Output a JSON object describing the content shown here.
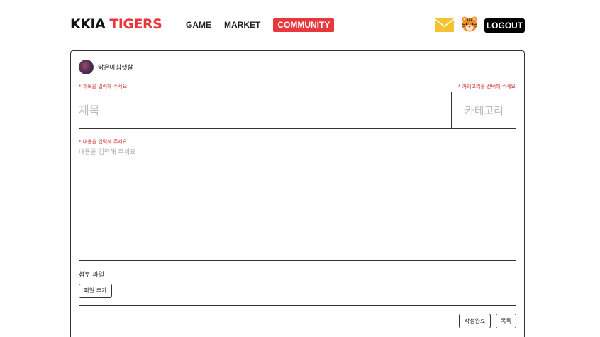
{
  "header": {
    "logo_part1": "KKIA",
    "logo_part2": " TIGERS",
    "nav": [
      {
        "label": "GAME",
        "active": false
      },
      {
        "label": "MARKET",
        "active": false
      },
      {
        "label": "COMMUNITY",
        "active": true
      }
    ],
    "icons": [
      "mail-icon",
      "tiger-icon"
    ],
    "logout_label": "LOGOUT"
  },
  "colors": {
    "accent": "#e8383d",
    "logout_bg": "#000000",
    "required_text": "#d23a3a",
    "mail": "#f5c331"
  },
  "form": {
    "author_name": "맑은아침햇살",
    "title_required": "* 제목을 입력해 주세요",
    "category_required": "* 카테고리를 선택해 주세요",
    "title_placeholder": "제목",
    "title_value": "",
    "category_placeholder": "카테고리",
    "body_required": "* 내용을 입력해 주세요",
    "body_placeholder": "내용을 입력해 주세요",
    "body_value": "",
    "attachment_label": "첨부 파일",
    "add_file_label": "파일 추가",
    "submit_label": "작성완료",
    "list_label": "목록"
  }
}
